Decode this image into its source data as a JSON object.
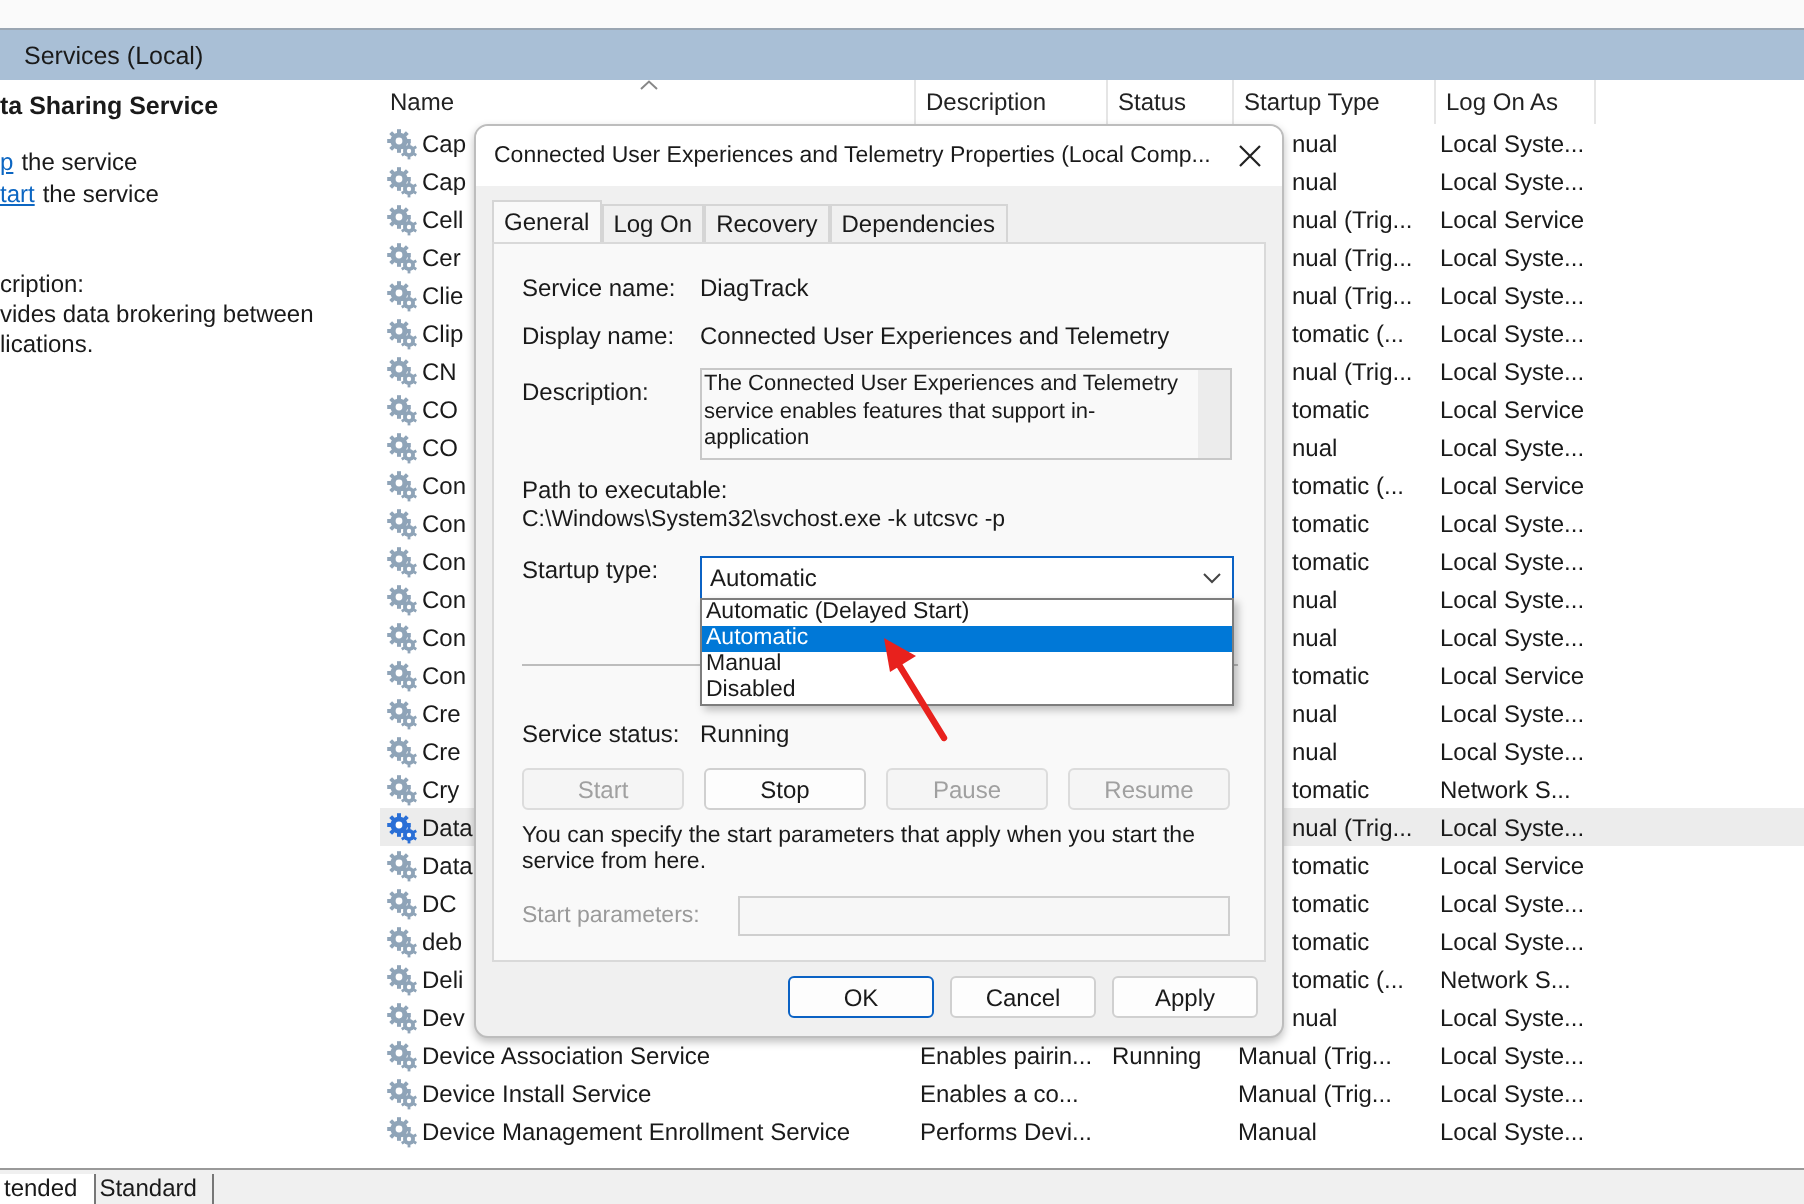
{
  "window": {
    "title": "Services (Local)"
  },
  "left_panel": {
    "service_title": "ta Sharing Service",
    "actions": [
      {
        "link": "p",
        "text": "the service"
      },
      {
        "link": "tart",
        "text": "the service"
      }
    ],
    "description_label": "cription:",
    "description_lines": [
      "vides data brokering between",
      "lications."
    ]
  },
  "table": {
    "columns": [
      {
        "label": "Name",
        "sorted": true
      },
      {
        "label": "Description",
        "sorted": false
      },
      {
        "label": "Status",
        "sorted": false
      },
      {
        "label": "Startup Type",
        "sorted": false
      },
      {
        "label": "Log On As",
        "sorted": false
      }
    ],
    "rows": [
      {
        "kind": "covered",
        "name": "Cap",
        "startup_type": "nual",
        "log_on_as": "Local Syste...",
        "selected": false
      },
      {
        "kind": "covered",
        "name": "Cap",
        "startup_type": "nual",
        "log_on_as": "Local Syste...",
        "selected": false
      },
      {
        "kind": "covered",
        "name": "Cell",
        "startup_type": "nual (Trig...",
        "log_on_as": "Local Service",
        "selected": false
      },
      {
        "kind": "covered",
        "name": "Cer",
        "startup_type": "nual (Trig...",
        "log_on_as": "Local Syste...",
        "selected": false
      },
      {
        "kind": "covered",
        "name": "Clie",
        "startup_type": "nual (Trig...",
        "log_on_as": "Local Syste...",
        "selected": false
      },
      {
        "kind": "covered",
        "name": "Clip",
        "startup_type": "tomatic (...",
        "log_on_as": "Local Syste...",
        "selected": false
      },
      {
        "kind": "covered",
        "name": "CN",
        "startup_type": "nual (Trig...",
        "log_on_as": "Local Syste...",
        "selected": false
      },
      {
        "kind": "covered",
        "name": "CO",
        "startup_type": "tomatic",
        "log_on_as": "Local Service",
        "selected": false
      },
      {
        "kind": "covered",
        "name": "CO",
        "startup_type": "nual",
        "log_on_as": "Local Syste...",
        "selected": false
      },
      {
        "kind": "covered",
        "name": "Con",
        "startup_type": "tomatic (...",
        "log_on_as": "Local Service",
        "selected": false
      },
      {
        "kind": "covered",
        "name": "Con",
        "startup_type": "tomatic",
        "log_on_as": "Local Syste...",
        "selected": false
      },
      {
        "kind": "covered",
        "name": "Con",
        "startup_type": "tomatic",
        "log_on_as": "Local Syste...",
        "selected": false
      },
      {
        "kind": "covered",
        "name": "Con",
        "startup_type": "nual",
        "log_on_as": "Local Syste...",
        "selected": false
      },
      {
        "kind": "covered",
        "name": "Con",
        "startup_type": "nual",
        "log_on_as": "Local Syste...",
        "selected": false
      },
      {
        "kind": "covered",
        "name": "Con",
        "startup_type": "tomatic",
        "log_on_as": "Local Service",
        "selected": false
      },
      {
        "kind": "covered",
        "name": "Cre",
        "startup_type": "nual",
        "log_on_as": "Local Syste...",
        "selected": false
      },
      {
        "kind": "covered",
        "name": "Cre",
        "startup_type": "nual",
        "log_on_as": "Local Syste...",
        "selected": false
      },
      {
        "kind": "covered",
        "name": "Cry",
        "startup_type": "tomatic",
        "log_on_as": "Network S...",
        "selected": false
      },
      {
        "kind": "covered",
        "name": "Data",
        "startup_type": "nual (Trig...",
        "log_on_as": "Local Syste...",
        "selected": true
      },
      {
        "kind": "covered",
        "name": "Data",
        "startup_type": "tomatic",
        "log_on_as": "Local Service",
        "selected": false
      },
      {
        "kind": "covered",
        "name": "DC",
        "startup_type": "tomatic",
        "log_on_as": "Local Syste...",
        "selected": false
      },
      {
        "kind": "covered",
        "name": "deb",
        "startup_type": "tomatic",
        "log_on_as": "Local Syste...",
        "selected": false
      },
      {
        "kind": "covered",
        "name": "Deli",
        "startup_type": "tomatic (...",
        "log_on_as": "Network S...",
        "selected": false
      },
      {
        "kind": "covered",
        "name": "Dev",
        "startup_type": "nual",
        "log_on_as": "Local Syste...",
        "selected": false
      },
      {
        "kind": "full",
        "name": "Device Association Service",
        "description": "Enables pairin...",
        "status": "Running",
        "startup_type": "Manual (Trig...",
        "log_on_as": "Local Syste...",
        "selected": false
      },
      {
        "kind": "full",
        "name": "Device Install Service",
        "description": "Enables a co...",
        "startup_type": "Manual (Trig...",
        "log_on_as": "Local Syste...",
        "selected": false
      },
      {
        "kind": "full",
        "name": "Device Management Enrollment Service",
        "description": "Performs Devi...",
        "startup_type": "Manual",
        "log_on_as": "Local Syste...",
        "selected": false
      }
    ]
  },
  "view_tabs": [
    {
      "label": "tended",
      "selected": true
    },
    {
      "label": "Standard",
      "selected": false
    }
  ],
  "dialog": {
    "title": "Connected User Experiences and Telemetry Properties (Local Comp...",
    "tabs": [
      {
        "label": "General",
        "selected": true
      },
      {
        "label": "Log On",
        "selected": false
      },
      {
        "label": "Recovery",
        "selected": false
      },
      {
        "label": "Dependencies",
        "selected": false
      }
    ],
    "service_name": {
      "label": "Service name:",
      "value": "DiagTrack"
    },
    "display_name": {
      "label": "Display name:",
      "value": "Connected User Experiences and Telemetry"
    },
    "description": {
      "label": "Description:",
      "value": "The Connected User Experiences and Telemetry service enables features that support in-application"
    },
    "path": {
      "label": "Path to executable:",
      "value": "C:\\Windows\\System32\\svchost.exe -k utcsvc -p"
    },
    "startup_type": {
      "label": "Startup type:",
      "value": "Automatic",
      "expanded": true,
      "options": [
        {
          "label": "Automatic (Delayed Start)",
          "selected": false
        },
        {
          "label": "Automatic",
          "selected": true
        },
        {
          "label": "Manual",
          "selected": false
        },
        {
          "label": "Disabled",
          "selected": false
        }
      ]
    },
    "service_status": {
      "label": "Service status:",
      "value": "Running"
    },
    "control_buttons": [
      {
        "label": "Start",
        "disabled": true
      },
      {
        "label": "Stop",
        "disabled": false
      },
      {
        "label": "Pause",
        "disabled": true
      },
      {
        "label": "Resume",
        "disabled": true
      }
    ],
    "hint": "You can specify the start parameters that apply when you start the service from here.",
    "start_parameters": {
      "label": "Start parameters:",
      "disabled": true
    },
    "buttons": [
      {
        "label": "OK",
        "default": true
      },
      {
        "label": "Cancel",
        "default": false
      },
      {
        "label": "Apply",
        "default": false
      }
    ]
  }
}
